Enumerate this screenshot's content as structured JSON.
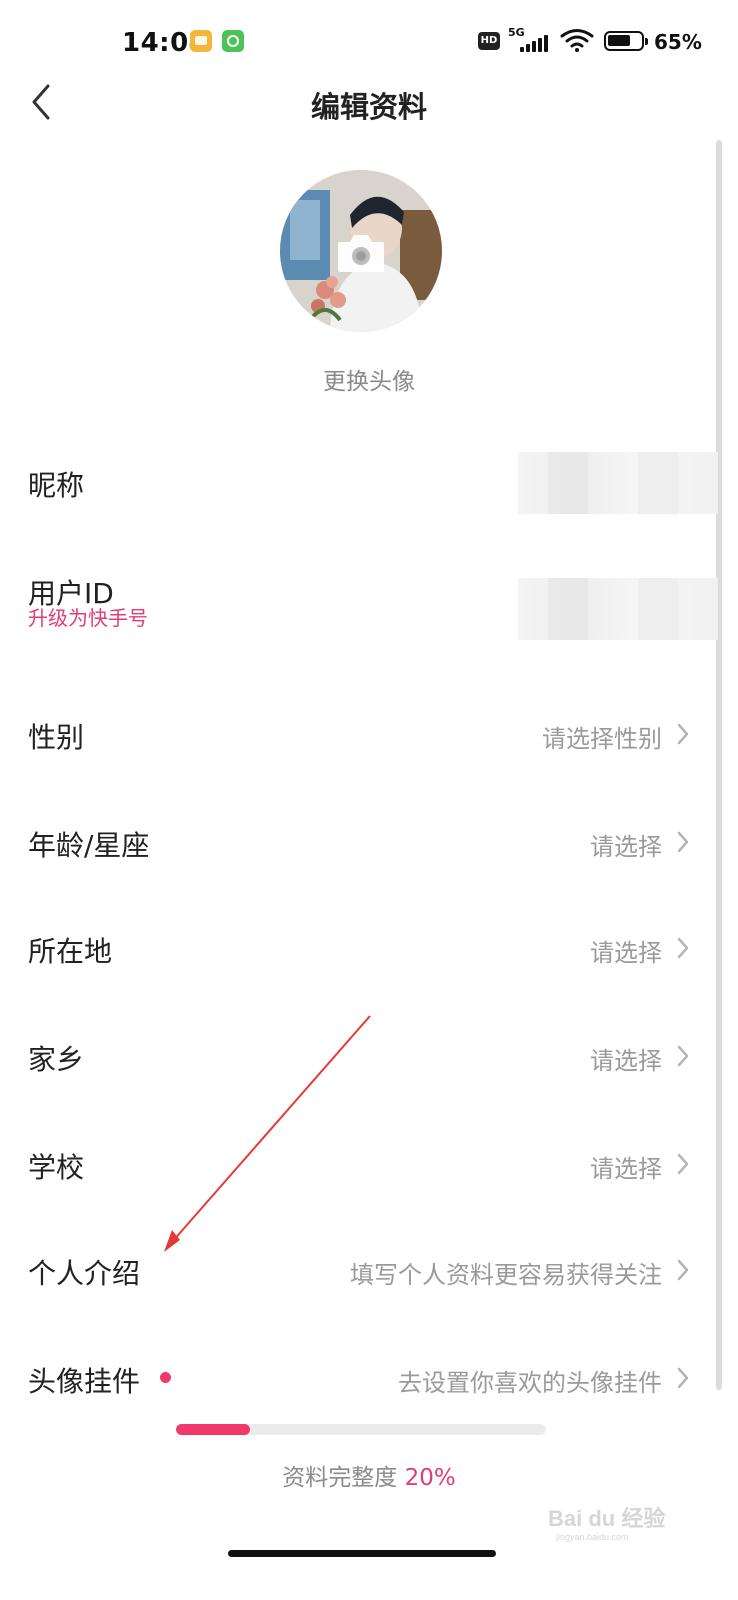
{
  "status_bar": {
    "time": "14:04",
    "network": "5G",
    "hd_label": "HD",
    "battery_percent": "65%"
  },
  "header": {
    "title": "编辑资料",
    "back_icon": "chevron-left-icon"
  },
  "avatar": {
    "change_label": "更换头像",
    "camera_icon": "camera-icon"
  },
  "rows": {
    "nickname": {
      "label": "昵称"
    },
    "user_id": {
      "label": "用户ID",
      "sub_label": "升级为快手号"
    },
    "gender": {
      "label": "性别",
      "value": "请选择性别"
    },
    "age": {
      "label": "年龄/星座",
      "value": "请选择"
    },
    "location": {
      "label": "所在地",
      "value": "请选择"
    },
    "hometown": {
      "label": "家乡",
      "value": "请选择"
    },
    "school": {
      "label": "学校",
      "value": "请选择"
    },
    "bio": {
      "label": "个人介绍",
      "value": "填写个人资料更容易获得关注"
    },
    "pendant": {
      "label": "头像挂件",
      "value": "去设置你喜欢的头像挂件"
    }
  },
  "completeness": {
    "label": "资料完整度",
    "percent_text": "20%",
    "fraction": 0.2
  },
  "watermark": {
    "text": "Bai du 经验",
    "subtext": "jingyan.baidu.com"
  },
  "colors": {
    "accent": "#f0386b",
    "accent_text": "#e23c73",
    "muted": "#9a9a9a",
    "annotation_arrow": "#e53935"
  }
}
